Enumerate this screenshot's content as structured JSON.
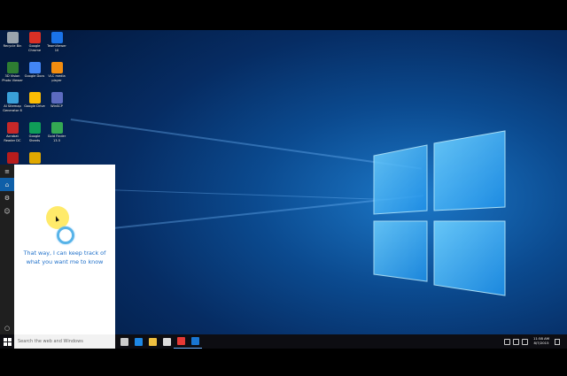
{
  "desktop": {
    "icons": [
      {
        "label": "Recycle Bin",
        "icon": "recycle-bin-icon",
        "color": "#9aa4ad"
      },
      {
        "label": "Google Chrome",
        "icon": "chrome-icon",
        "color": "#d93025"
      },
      {
        "label": "TeamViewer 10",
        "icon": "teamviewer-icon",
        "color": "#1a73e8"
      },
      {
        "label": "3D Vision Photo Viewer",
        "icon": "photo-viewer-icon",
        "color": "#2e7d32"
      },
      {
        "label": "Google Docs",
        "icon": "docs-icon",
        "color": "#4285f4"
      },
      {
        "label": "VLC media player",
        "icon": "vlc-icon",
        "color": "#f28c0f"
      },
      {
        "label": "AI Sitemap Generator 8",
        "icon": "sitemap-icon",
        "color": "#3aa0d8"
      },
      {
        "label": "Google Drive",
        "icon": "drive-icon",
        "color": "#fbbc04"
      },
      {
        "label": "WinSCP",
        "icon": "winscp-icon",
        "color": "#5c6bc0"
      },
      {
        "label": "Acrobat Reader DC",
        "icon": "acrobat-icon",
        "color": "#c62828"
      },
      {
        "label": "Google Sheets",
        "icon": "sheets-icon",
        "color": "#0f9d58"
      },
      {
        "label": "Gold Finder 13.5",
        "icon": "gold-finder-icon",
        "color": "#34a853"
      },
      {
        "label": "",
        "icon": "adobe-icon",
        "color": "#b71c1c"
      },
      {
        "label": "",
        "icon": "folder-icon",
        "color": "#e0a800"
      }
    ]
  },
  "cortana": {
    "message_line1": "That way, I can keep track of",
    "message_line2": "what you want me to know",
    "rail": {
      "menu_icon": "hamburger-icon",
      "home_icon": "home-icon",
      "notebook_icon": "notebook-icon",
      "feedback_icon": "feedback-icon",
      "mic_icon": "cortana-circle-icon"
    }
  },
  "taskbar": {
    "search_placeholder": "Search the web and Windows",
    "apps": [
      {
        "name": "task-view-icon",
        "color": "#cccccc"
      },
      {
        "name": "edge-icon",
        "color": "#1e88e5"
      },
      {
        "name": "file-explorer-icon",
        "color": "#f0c040"
      },
      {
        "name": "store-icon",
        "color": "#dddddd"
      },
      {
        "name": "chrome-icon",
        "color": "#e53935"
      },
      {
        "name": "app-icon",
        "color": "#1976d2"
      }
    ],
    "clock_time": "11:58 AM",
    "clock_date": "8/7/2015"
  }
}
